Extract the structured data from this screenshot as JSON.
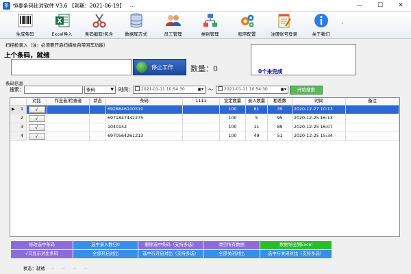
{
  "window": {
    "title": "恒泰条码比对软件 V3.6 【到期：2021-06-19】",
    "title_menu": "...",
    "minimize": "—",
    "maximize": "☐",
    "close": "✕"
  },
  "toolbar": {
    "items": [
      {
        "label": "生成条码",
        "icon": "barcode-icon"
      },
      {
        "label": "Excel导入",
        "icon": "excel-icon"
      },
      {
        "label": "条码截取/包含",
        "icon": "scissors-icon"
      },
      {
        "label": "数据库方式",
        "icon": "database-icon"
      },
      {
        "label": "员工管理",
        "icon": "users-icon"
      },
      {
        "label": "类别管理",
        "icon": "network-icon"
      },
      {
        "label": "程序配置",
        "icon": "gears-icon"
      },
      {
        "label": "注册账号登录",
        "icon": "notepad-icon"
      },
      {
        "label": "关于我们",
        "icon": "info-icon"
      }
    ],
    "more": "·"
  },
  "scan": {
    "group_title": "扫描枪录入（注：必须要开启扫描枪自带回车功能）",
    "status": "上个条码，就绪",
    "input_value": "",
    "stop_label": "停止工作",
    "qty_label": "数量：",
    "qty_value": "0",
    "unfinished": "0个未完成"
  },
  "filter": {
    "group_title": "条码信息",
    "search_label": "搜索：",
    "search_value": "",
    "field_value": "条码",
    "time_label": "时间：",
    "date_from": "2021-01-11  10:54:30",
    "tilde": "～",
    "date_to": "2021-01-11  10:54:30",
    "search_button": "开始搜索"
  },
  "grid": {
    "columns": [
      "",
      "对比",
      "作业者/检查者",
      "状态",
      "条码",
      "1111",
      "设定数量",
      "录入数量",
      "相差数",
      "时间",
      "备注"
    ],
    "rows": [
      {
        "no": "1",
        "check": "√",
        "operator": "",
        "status": "",
        "barcode": "6928846100510",
        "c1111": "",
        "set_qty": "100",
        "entered": "61",
        "diff": "39",
        "time": "2020-12-27  10:13",
        "remark": ""
      },
      {
        "no": "2",
        "check": "√",
        "operator": "",
        "status": "",
        "barcode": "6971847442275",
        "c1111": "",
        "set_qty": "100",
        "entered": "5",
        "diff": "95",
        "time": "2020-12-25  16:13",
        "remark": ""
      },
      {
        "no": "3",
        "check": "√",
        "operator": "",
        "status": "",
        "barcode": "1040142",
        "c1111": "",
        "set_qty": "100",
        "entered": "11",
        "diff": "89",
        "time": "2020-12-25  16:07",
        "remark": ""
      },
      {
        "no": "4",
        "check": "√",
        "operator": "",
        "status": "",
        "barcode": "6970564261213",
        "c1111": "",
        "set_qty": "100",
        "entered": "49",
        "diff": "51",
        "time": "2020-12-25  15:34",
        "remark": ""
      }
    ]
  },
  "actions": {
    "row1": [
      {
        "label": "修改选中条码",
        "color": "purple"
      },
      {
        "label": "选中录入数归0",
        "color": "blue"
      },
      {
        "label": "删除选中条码（支持多选）",
        "color": "purple"
      },
      {
        "label": "清空所有数据",
        "color": "purple"
      },
      {
        "label": "数据导出到Excel",
        "color": "green"
      }
    ],
    "row2": [
      {
        "label": "√只显示对比条码",
        "color": "purple"
      },
      {
        "label": "全部开启对比",
        "color": "blue"
      },
      {
        "label": "选中行开启对比（支持多选）",
        "color": "blue"
      },
      {
        "label": "全部关闭对比",
        "color": "blue"
      },
      {
        "label": "选中行关闭对比（支持多选）",
        "color": "blue"
      }
    ]
  },
  "status": {
    "state_label": "状态：就绪",
    "frag1": "...",
    "frag2": "...",
    "frag3": "...",
    "frag4": "..."
  }
}
